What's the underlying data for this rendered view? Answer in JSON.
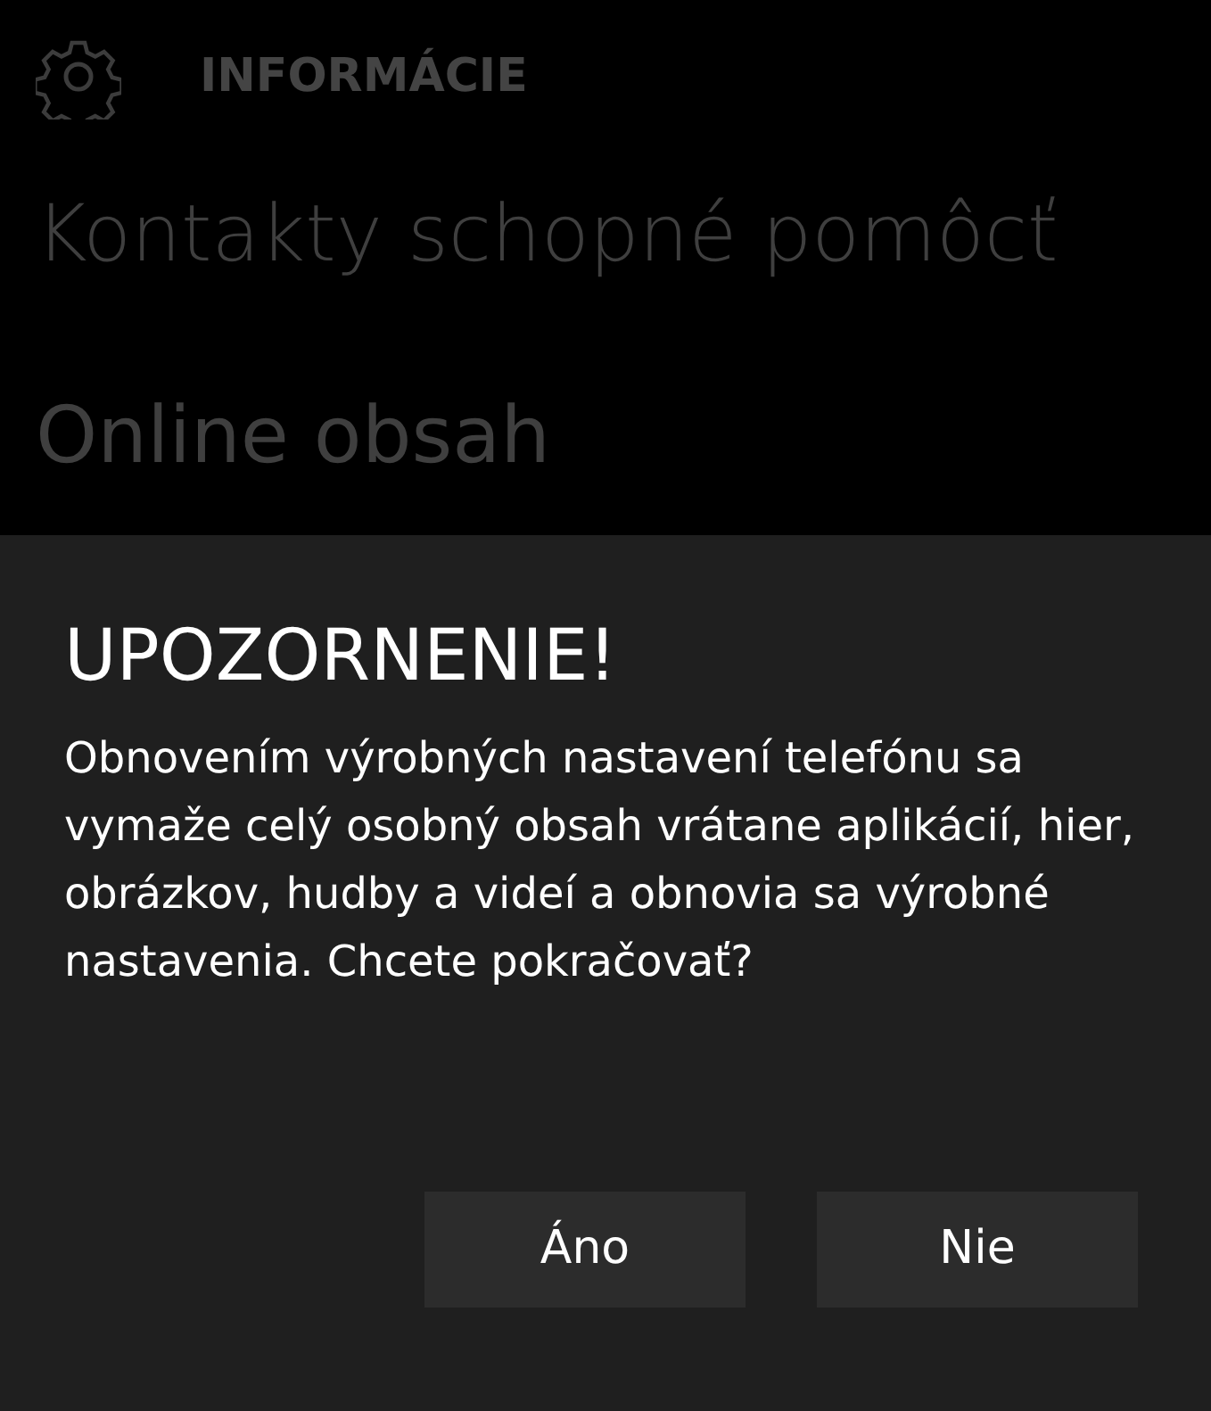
{
  "header": {
    "title": "INFORMÁCIE"
  },
  "items": [
    "Kontakty schopné pomôcť",
    "Online obsah"
  ],
  "dialog": {
    "title": "UPOZORNENIE!",
    "message": "Obnovením výrobných nastavení telefónu sa vymaže celý osobný obsah vrátane aplikácií, hier, obrázkov, hudby a videí a obnovia sa výrobné nastavenia. Chcete pokračovať?",
    "buttons": [
      "Áno",
      "Nie"
    ]
  }
}
